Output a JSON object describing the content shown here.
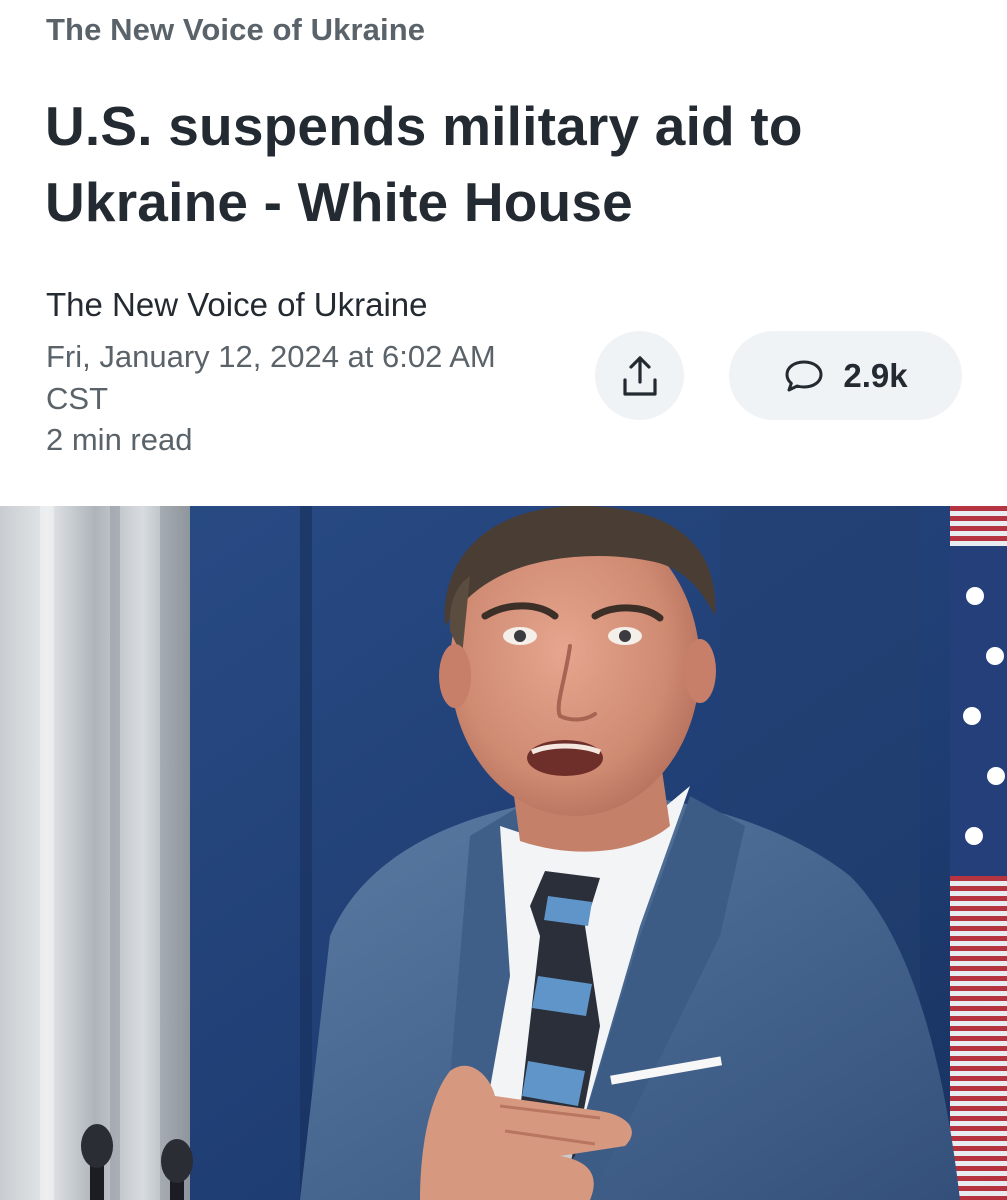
{
  "article": {
    "publisher_header": "The New Voice of Ukraine",
    "headline": "U.S. suspends military aid to Ukraine - White House",
    "author": "The New Voice of Ukraine",
    "date": "Fri, January 12, 2024 at 6:02 AM CST",
    "read_time": "2 min read"
  },
  "actions": {
    "share_icon": "share-icon",
    "comment_icon": "speech-bubble-icon",
    "comment_count": "2.9k"
  },
  "hero_image": {
    "description_icon": "photo"
  },
  "colors": {
    "text_primary": "#232a31",
    "text_secondary": "#5b636a",
    "button_bg": "#f0f3f5"
  }
}
